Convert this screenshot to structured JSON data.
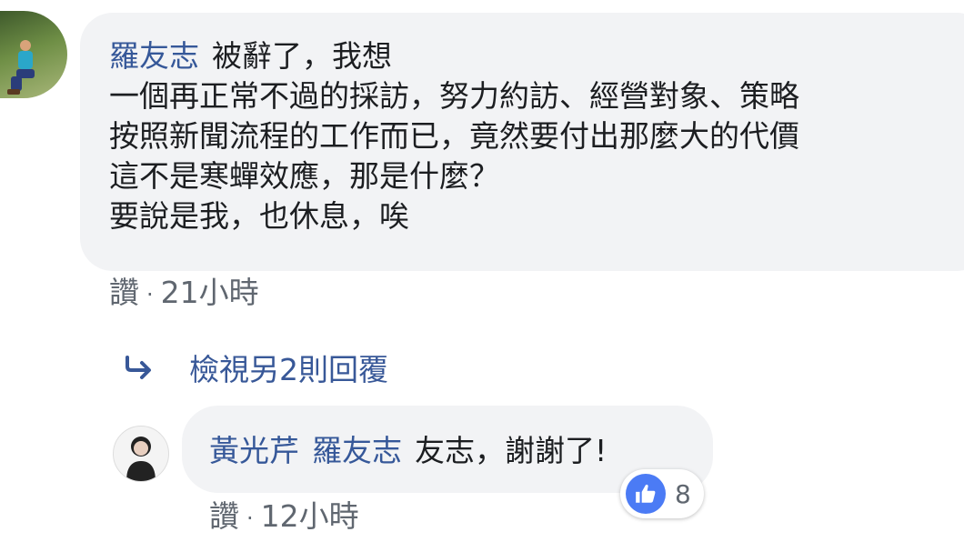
{
  "main_comment": {
    "author": "羅友志",
    "lines": [
      "被辭了，我想",
      "一個再正常不過的採訪，努力約訪、經營對象、策略",
      "按照新聞流程的工作而已，竟然要付出那麼大的代價",
      "這不是寒蟬效應，那是什麼？",
      "要說是我，也休息，唉"
    ],
    "like_label": "讚",
    "separator": "·",
    "time": "21小時"
  },
  "view_replies": {
    "label": "檢視另2則回覆"
  },
  "reply": {
    "author": "黃光芹",
    "mention": "羅友志",
    "text": "友志，謝謝了!",
    "like_label": "讚",
    "separator": "·",
    "time": "12小時",
    "reaction_count": "8"
  },
  "colors": {
    "link": "#365899",
    "bubble": "#f2f3f5",
    "meta": "#606770",
    "like_reaction": "#4b7bf5"
  }
}
